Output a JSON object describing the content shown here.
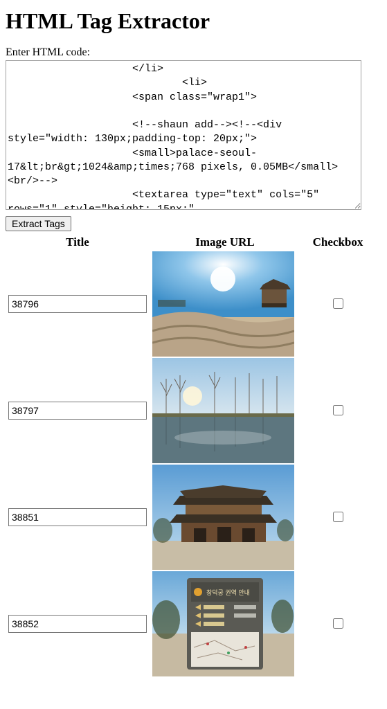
{
  "page_title": "HTML Tag Extractor",
  "input_label": "Enter HTML code:",
  "textarea_value": "                    </li>\n                            <li>\n                    <span class=\"wrap1\">\n\n                    <!--shaun add--><!--<div style=\"width: 130px;padding-top: 20px;\">\n                    <small>palace-seoul-17&lt;br&gt;1024&amp;times;768 pixels, 0.05MB</small><br/>-->\n                    <textarea type=\"text\" cols=\"5\" rows=\"1\" style=\"height: 15px;\"",
  "extract_button_label": "Extract Tags",
  "table": {
    "headers": {
      "title": "Title",
      "image_url": "Image URL",
      "checkbox": "Checkbox"
    },
    "rows": [
      {
        "title": "38796",
        "checked": false
      },
      {
        "title": "38797",
        "checked": false
      },
      {
        "title": "38851",
        "checked": false
      },
      {
        "title": "38852",
        "checked": false
      }
    ]
  }
}
